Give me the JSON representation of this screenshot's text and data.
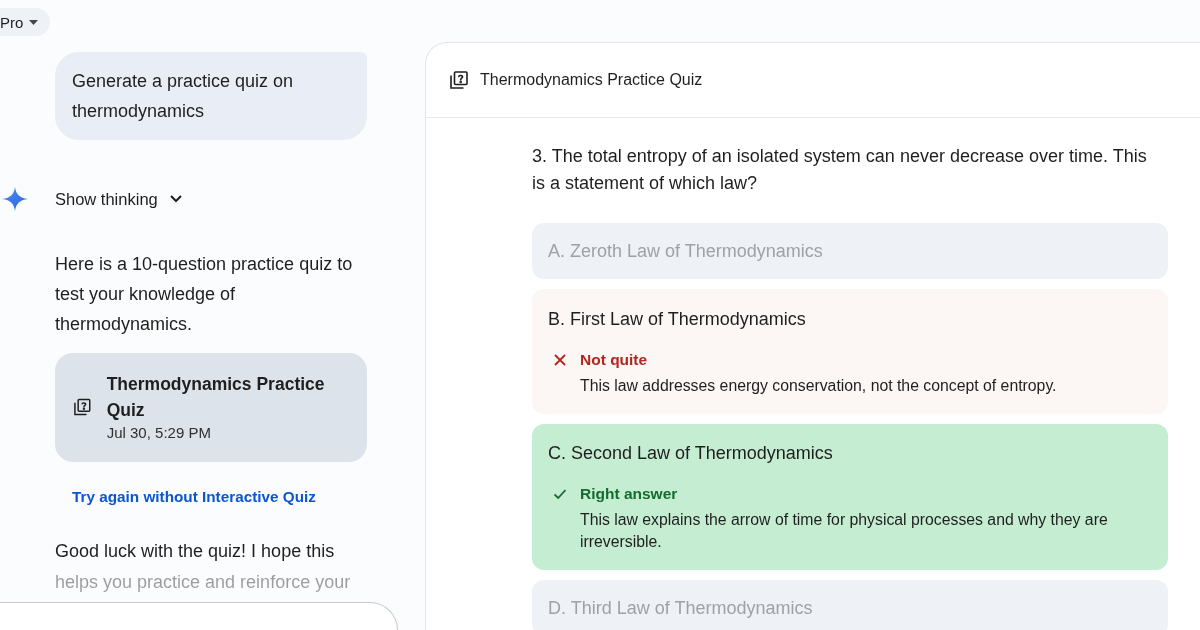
{
  "model_picker": {
    "label": "Pro"
  },
  "conversation": {
    "user_message": "Generate a practice quiz on thermodynamics",
    "thinking_toggle": {
      "label": "Show thinking",
      "expanded": false
    },
    "response_intro": "Here is a 10-question practice quiz to test your knowledge of thermodynamics.",
    "quiz_card": {
      "title": "Thermodynamics Practice Quiz",
      "timestamp": "Jul 30, 5:29 PM"
    },
    "retry_link": "Try again without Interactive Quiz",
    "response_outro": "Good luck with the quiz! I hope this helps you practice and reinforce your"
  },
  "quiz_panel": {
    "title": "Thermodynamics Practice Quiz",
    "question": "3. The total entropy of an isolated system can never decrease over time. This is a statement of which law?",
    "options": [
      {
        "label": "A. Zeroth Law of Thermodynamics",
        "kind": "dimmed"
      },
      {
        "label": "B. First Law of Thermodynamics",
        "kind": "incorrect",
        "feedback": {
          "label": "Not quite",
          "explanation": "This law addresses energy conservation, not the concept of entropy."
        }
      },
      {
        "label": "C. Second Law of Thermodynamics",
        "kind": "correct",
        "feedback": {
          "label": "Right answer",
          "explanation": "This law explains the arrow of time for physical processes and why they are irreversible."
        }
      },
      {
        "label": "D. Third Law of Thermodynamics",
        "kind": "dimmed"
      }
    ]
  }
}
